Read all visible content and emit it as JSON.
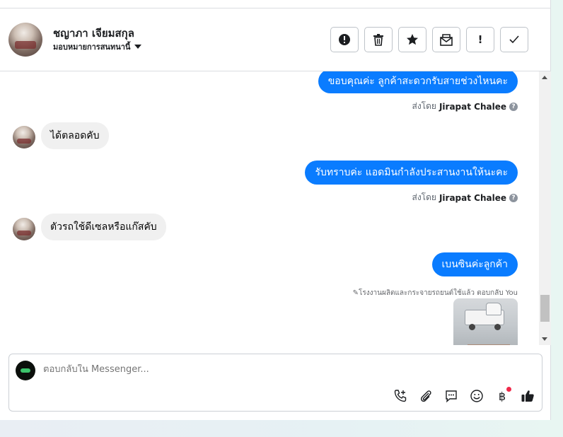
{
  "header": {
    "contact_name": "ชญาภา เจียมสกุล",
    "assign_label": "มอบหมายการสนทนานี้",
    "actions": [
      {
        "icon": "spam-icon",
        "glyph": "!"
      },
      {
        "icon": "trash-icon",
        "glyph": "🗑"
      },
      {
        "icon": "star-icon",
        "glyph": "★"
      },
      {
        "icon": "mark-unread-icon",
        "glyph": "✉"
      },
      {
        "icon": "follow-up-icon",
        "glyph": "!"
      },
      {
        "icon": "done-icon",
        "glyph": "✓"
      }
    ]
  },
  "messages": [
    {
      "direction": "out",
      "text": "ขอบคุณค่ะ ลูกค้าสะดวกรับสายช่วงไหนคะ"
    },
    {
      "type": "sentby",
      "prefix": "ส่งโดย",
      "author": "Jirapat Chalee",
      "help": "?"
    },
    {
      "direction": "in",
      "text": "ได้ตลอดคับ"
    },
    {
      "direction": "out",
      "text": "รับทราบค่ะ แอดมินกำลังประสานงานให้นะคะ"
    },
    {
      "type": "sentby",
      "prefix": "ส่งโดย",
      "author": "Jirapat Chalee",
      "help": "?"
    },
    {
      "direction": "in",
      "text": "ตัวรถใช้ดีเซลหรือแก๊สคับ"
    },
    {
      "direction": "out",
      "text": "เบนซินค่ะลูกค้า"
    },
    {
      "type": "reply_note",
      "text": "✎โรงงานผลิตและกระจายรถยนต์ใช้แล้ว ตอบกลับ You"
    }
  ],
  "composer": {
    "placeholder": "ตอบกลับใน Messenger...",
    "tools": [
      "call-add-icon",
      "attachment-icon",
      "saved-replies-icon",
      "emoji-icon",
      "payment-icon",
      "like-icon"
    ],
    "payment_glyph": "฿"
  },
  "colors": {
    "outgoing_bubble": "#0a7cff",
    "incoming_bubble": "#f0f0f0",
    "notification_dot": "#f02849"
  }
}
